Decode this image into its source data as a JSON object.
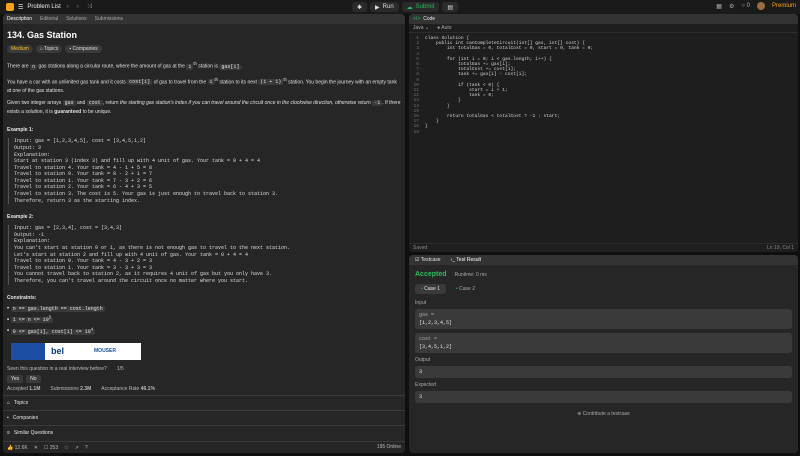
{
  "topbar": {
    "problem_list": "Problem List",
    "run": "Run",
    "submit": "Submit",
    "premium": "Premium",
    "counter": "0"
  },
  "left": {
    "tabs": [
      "Description",
      "Editorial",
      "Solutions",
      "Submissions"
    ],
    "title": "134. Gas Station",
    "difficulty": "Medium",
    "topics_chip": "Topics",
    "companies_chip": "Companies",
    "desc": [
      {
        "a": "There are ",
        "c1": "n",
        "b": " gas stations along a circular route, where the amount of gas at the ",
        "c2": "i",
        "sup": "th",
        "c": " station is ",
        "c3": "gas[i]",
        "d": "."
      },
      {
        "a": "You have a car with an unlimited gas tank and it costs ",
        "c1": "cost[i]",
        "b": " of gas to travel from the ",
        "c2": "i",
        "sup": "th",
        "c": " station to its next ",
        "c3": "(i + 1)",
        "sup2": "th",
        "d": " station. You begin the journey with an empty tank at one of the gas stations."
      }
    ],
    "desc3_a": "Given two integer arrays ",
    "desc3_gas": "gas",
    "desc3_and": " and ",
    "desc3_cost": "cost",
    "desc3_b": ", return ",
    "desc3_italic": "the starting gas station's index if you can travel around the circuit once in the clockwise direction, otherwise return",
    "desc3_neg": "-1",
    "desc3_c": ". If there exists a solution, it is ",
    "desc3_bold": "guaranteed",
    "desc3_d": " to be unique.",
    "examples": [
      {
        "title": "Example 1:",
        "lines": [
          "Input: gas = [1,2,3,4,5], cost = [3,4,5,1,2]",
          "Output: 3",
          "Explanation:",
          "Start at station 3 (index 3) and fill up with 4 unit of gas. Your tank = 0 + 4 = 4",
          "Travel to station 4. Your tank = 4 - 1 + 5 = 8",
          "Travel to station 0. Your tank = 8 - 2 + 1 = 7",
          "Travel to station 1. Your tank = 7 - 3 + 2 = 6",
          "Travel to station 2. Your tank = 6 - 4 + 3 = 5",
          "Travel to station 3. The cost is 5. Your gas is just enough to travel back to station 3.",
          "Therefore, return 3 as the starting index."
        ]
      },
      {
        "title": "Example 2:",
        "lines": [
          "Input: gas = [2,3,4], cost = [3,4,3]",
          "Output: -1",
          "Explanation:",
          "You can't start at station 0 or 1, as there is not enough gas to travel to the next station.",
          "Let's start at station 2 and fill up with 4 unit of gas. Your tank = 0 + 4 = 4",
          "Travel to station 0. Your tank = 4 - 3 + 2 = 3",
          "Travel to station 1. Your tank = 3 - 3 + 3 = 3",
          "You cannot travel back to station 2, as it requires 4 unit of gas but you only have 3.",
          "Therefore, you can't travel around the circuit once no matter where you start."
        ]
      }
    ],
    "constraints_title": "Constraints:",
    "constraints": [
      "n == gas.length == cost.length",
      "1 <= n <= 10",
      "0 <= gas[i], cost[i] <= 10"
    ],
    "constraint_sups": [
      "",
      "5",
      "4"
    ],
    "ad_brand": "bel",
    "ad_partner": "MOUSER",
    "interview_q": "Seen this question in a real interview before?",
    "interview_count": "1/5",
    "yes": "Yes",
    "no": "No",
    "stats": {
      "accepted_label": "Accepted",
      "accepted": "1.1M",
      "submissions_label": "Submissions",
      "submissions": "2.3M",
      "rate_label": "Acceptance Rate",
      "rate": "46.1%"
    },
    "sections": [
      "Topics",
      "Companies",
      "Similar Questions"
    ],
    "likes": "12.6K",
    "comments": "253",
    "online": "195 Online"
  },
  "code": {
    "header": "Code",
    "language": "Java",
    "auto": "Auto",
    "lines": [
      "class Solution {",
      "    public int canCompleteCircuit(int[] gas, int[] cost) {",
      "        int totalGas = 0, totalCost = 0, start = 0, tank = 0;",
      "",
      "        for (int i = 0; i < gas.length; i++) {",
      "            totalGas += gas[i];",
      "            totalCost += cost[i];",
      "            tank += gas[i] - cost[i];",
      "",
      "            if (tank < 0) {",
      "                start = i + 1;",
      "                tank = 0;",
      "            }",
      "        }",
      "",
      "        return totalGas < totalCost ? -1 : start;",
      "    }",
      "}",
      ""
    ],
    "saved": "Saved",
    "position": "Ln 19, Col 1"
  },
  "result": {
    "tab_testcase": "Testcase",
    "tab_result": "Test Result",
    "status": "Accepted",
    "runtime": "Runtime: 0 ms",
    "case1": "Case 1",
    "case2": "Case 2",
    "input_label": "Input",
    "gas_var": "gas =",
    "gas_val": "[1,2,3,4,5]",
    "cost_var": "cost =",
    "cost_val": "[3,4,5,1,2]",
    "output_label": "Output",
    "output_val": "3",
    "expected_label": "Expected",
    "expected_val": "3",
    "contribute": "Contribute a testcase"
  }
}
